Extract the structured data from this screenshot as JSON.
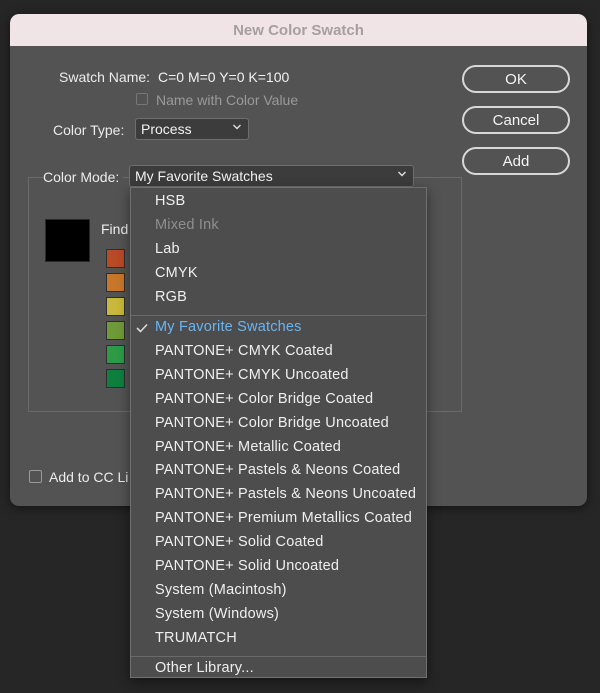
{
  "dialog": {
    "title": "New Color Swatch",
    "swatch_name_label": "Swatch Name:",
    "swatch_name_value": "C=0 M=0 Y=0 K=100",
    "name_with_color_value_label": "Name with Color Value",
    "color_type_label": "Color Type:",
    "color_type_value": "Process",
    "color_mode_label": "Color Mode:",
    "color_mode_value": "My Favorite Swatches",
    "find_label": "Find",
    "add_to_cc_label": "Add to CC Li",
    "buttons": {
      "ok": "OK",
      "cancel": "Cancel",
      "add": "Add"
    }
  },
  "swatch_chips": [
    "#b84a25",
    "#c7772a",
    "#c9b83a",
    "#6f9a38",
    "#2e9a45",
    "#0f7f3e"
  ],
  "menu": {
    "group1": [
      {
        "label": "HSB",
        "disabled": false
      },
      {
        "label": "Mixed Ink",
        "disabled": true
      },
      {
        "label": "Lab",
        "disabled": false
      },
      {
        "label": "CMYK",
        "disabled": false
      },
      {
        "label": "RGB",
        "disabled": false
      }
    ],
    "group2": [
      {
        "label": "My Favorite Swatches",
        "selected": true
      },
      {
        "label": "PANTONE+ CMYK Coated"
      },
      {
        "label": "PANTONE+ CMYK Uncoated"
      },
      {
        "label": "PANTONE+ Color Bridge Coated"
      },
      {
        "label": "PANTONE+ Color Bridge Uncoated"
      },
      {
        "label": "PANTONE+ Metallic Coated"
      },
      {
        "label": "PANTONE+ Pastels & Neons Coated"
      },
      {
        "label": "PANTONE+ Pastels & Neons Uncoated"
      },
      {
        "label": "PANTONE+ Premium Metallics Coated"
      },
      {
        "label": "PANTONE+ Solid Coated"
      },
      {
        "label": "PANTONE+ Solid Uncoated"
      },
      {
        "label": "System (Macintosh)"
      },
      {
        "label": "System (Windows)"
      },
      {
        "label": "TRUMATCH"
      }
    ],
    "group3": [
      {
        "label": "Other Library..."
      }
    ]
  },
  "colors": {
    "selected_item": "#6ab4f2",
    "dialog_bg": "#535353",
    "titlebar_bg": "#f0e4e6"
  }
}
